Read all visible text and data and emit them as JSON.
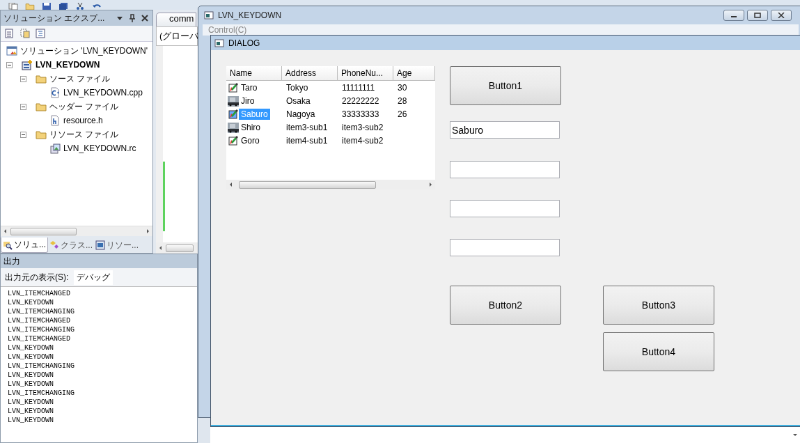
{
  "solution_explorer": {
    "title": "ソリューション エクスプ...",
    "tree": [
      {
        "label": "ソリューション 'LVN_KEYDOWN'",
        "kind": "solution",
        "children": [
          {
            "label": "LVN_KEYDOWN",
            "kind": "project",
            "expanded": true,
            "children": [
              {
                "label": "ソース ファイル",
                "kind": "folder",
                "expanded": true,
                "children": [
                  {
                    "label": "LVN_KEYDOWN.cpp",
                    "kind": "cpp"
                  }
                ]
              },
              {
                "label": "ヘッダー ファイル",
                "kind": "folder",
                "expanded": true,
                "children": [
                  {
                    "label": "resource.h",
                    "kind": "header"
                  }
                ]
              },
              {
                "label": "リソース ファイル",
                "kind": "folder",
                "expanded": true,
                "children": [
                  {
                    "label": "LVN_KEYDOWN.rc",
                    "kind": "resource"
                  }
                ]
              }
            ]
          }
        ]
      }
    ],
    "tabs": [
      {
        "label": "ソリュ...",
        "kind": "solution",
        "selected": true
      },
      {
        "label": "クラス...",
        "kind": "class",
        "selected": false
      },
      {
        "label": "リソー...",
        "kind": "resource",
        "selected": false
      }
    ]
  },
  "editor": {
    "tab": "comm",
    "scope": "(グローバ"
  },
  "output": {
    "title": "出力",
    "source_label": "出力元の表示(S):",
    "source_value": "デバッグ",
    "lines": [
      "LVN_ITEMCHANGED",
      "LVN_KEYDOWN",
      "LVN_ITEMCHANGING",
      "LVN_ITEMCHANGED",
      "LVN_ITEMCHANGING",
      "LVN_ITEMCHANGED",
      "LVN_KEYDOWN",
      "LVN_KEYDOWN",
      "LVN_ITEMCHANGING",
      "LVN_KEYDOWN",
      "LVN_KEYDOWN",
      "LVN_ITEMCHANGING",
      "LVN_KEYDOWN",
      "LVN_KEYDOWN",
      "LVN_KEYDOWN"
    ]
  },
  "main_window": {
    "title": "LVN_KEYDOWN",
    "menu": [
      "Control(C)"
    ]
  },
  "dialog": {
    "title": "DIALOG",
    "list": {
      "columns": [
        "Name",
        "Address",
        "PhoneNu...",
        "Age"
      ],
      "rows": [
        {
          "kind": "pencil",
          "selected": false,
          "cells": [
            "Taro",
            "Tokyo",
            "11111111",
            "30"
          ]
        },
        {
          "kind": "car",
          "selected": false,
          "cells": [
            "Jiro",
            "Osaka",
            "22222222",
            "28"
          ]
        },
        {
          "kind": "pencil",
          "selected": true,
          "cells": [
            "Saburo",
            "Nagoya",
            "33333333",
            "26"
          ]
        },
        {
          "kind": "car",
          "selected": false,
          "cells": [
            "Shiro",
            "item3-sub1",
            "item3-sub2"
          ]
        },
        {
          "kind": "pencil",
          "selected": false,
          "cells": [
            "Goro",
            "item4-sub1",
            "item4-sub2"
          ]
        }
      ]
    },
    "fields": [
      {
        "kind": "text",
        "value": "Saburo"
      },
      {
        "kind": "text"
      },
      {
        "kind": "text"
      },
      {
        "kind": "text"
      }
    ],
    "buttons": [
      "Button1",
      "Button2",
      "Button3",
      "Button4"
    ]
  }
}
